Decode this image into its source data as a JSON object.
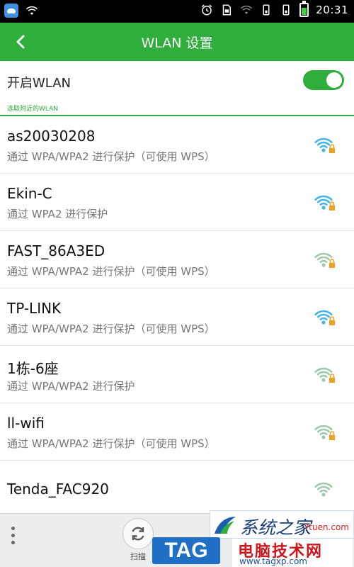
{
  "status_bar": {
    "time": "20:31",
    "icons": [
      "app-icon",
      "wifi-icon",
      "alarm-icon",
      "sim-card-icon",
      "wifi-icon",
      "phone-icon",
      "phone-icon",
      "battery-icon"
    ]
  },
  "header": {
    "title": "WLAN 设置",
    "back_icon": "chevron-left-icon"
  },
  "wlan_toggle": {
    "label": "开启WLAN",
    "enabled": true
  },
  "section": {
    "label": "选取附近的WLAN"
  },
  "networks": [
    {
      "name": "as20030208",
      "security": "通过 WPA/WPA2 进行保护（可使用 WPS）",
      "signal_bars": 4,
      "locked": true
    },
    {
      "name": "Ekin-C",
      "security": "通过 WPA2 进行保护",
      "signal_bars": 4,
      "locked": true
    },
    {
      "name": "FAST_86A3ED",
      "security": "通过 WPA/WPA2 进行保护（可使用 WPS）",
      "signal_bars": 3,
      "locked": true
    },
    {
      "name": "TP-LINK",
      "security": "通过 WPA/WPA2 进行保护（可使用 WPS）",
      "signal_bars": 4,
      "locked": true
    },
    {
      "name": "1栋-6座",
      "security": "通过 WPA/WPA2 进行保护",
      "signal_bars": 3,
      "locked": true
    },
    {
      "name": "ll-wifi",
      "security": "通过 WPA/WPA2 进行保护（可使用 WPS）",
      "signal_bars": 3,
      "locked": true
    },
    {
      "name": "Tenda_FAC920",
      "security": "",
      "signal_bars": 3,
      "locked": false
    }
  ],
  "bottom_bar": {
    "scan_label": "扫描"
  },
  "watermark": {
    "brand_cn": "系统之家",
    "url1": "Ytuen.com",
    "tag": "TAG",
    "site_cn": "电脑技术网",
    "url2": "www.tagxp.com"
  },
  "colors": {
    "accent": "#2fae3b",
    "wifi_active": "#3fb6e6",
    "wifi_weak": "#9ec9a8",
    "lock": "#f0a020"
  }
}
